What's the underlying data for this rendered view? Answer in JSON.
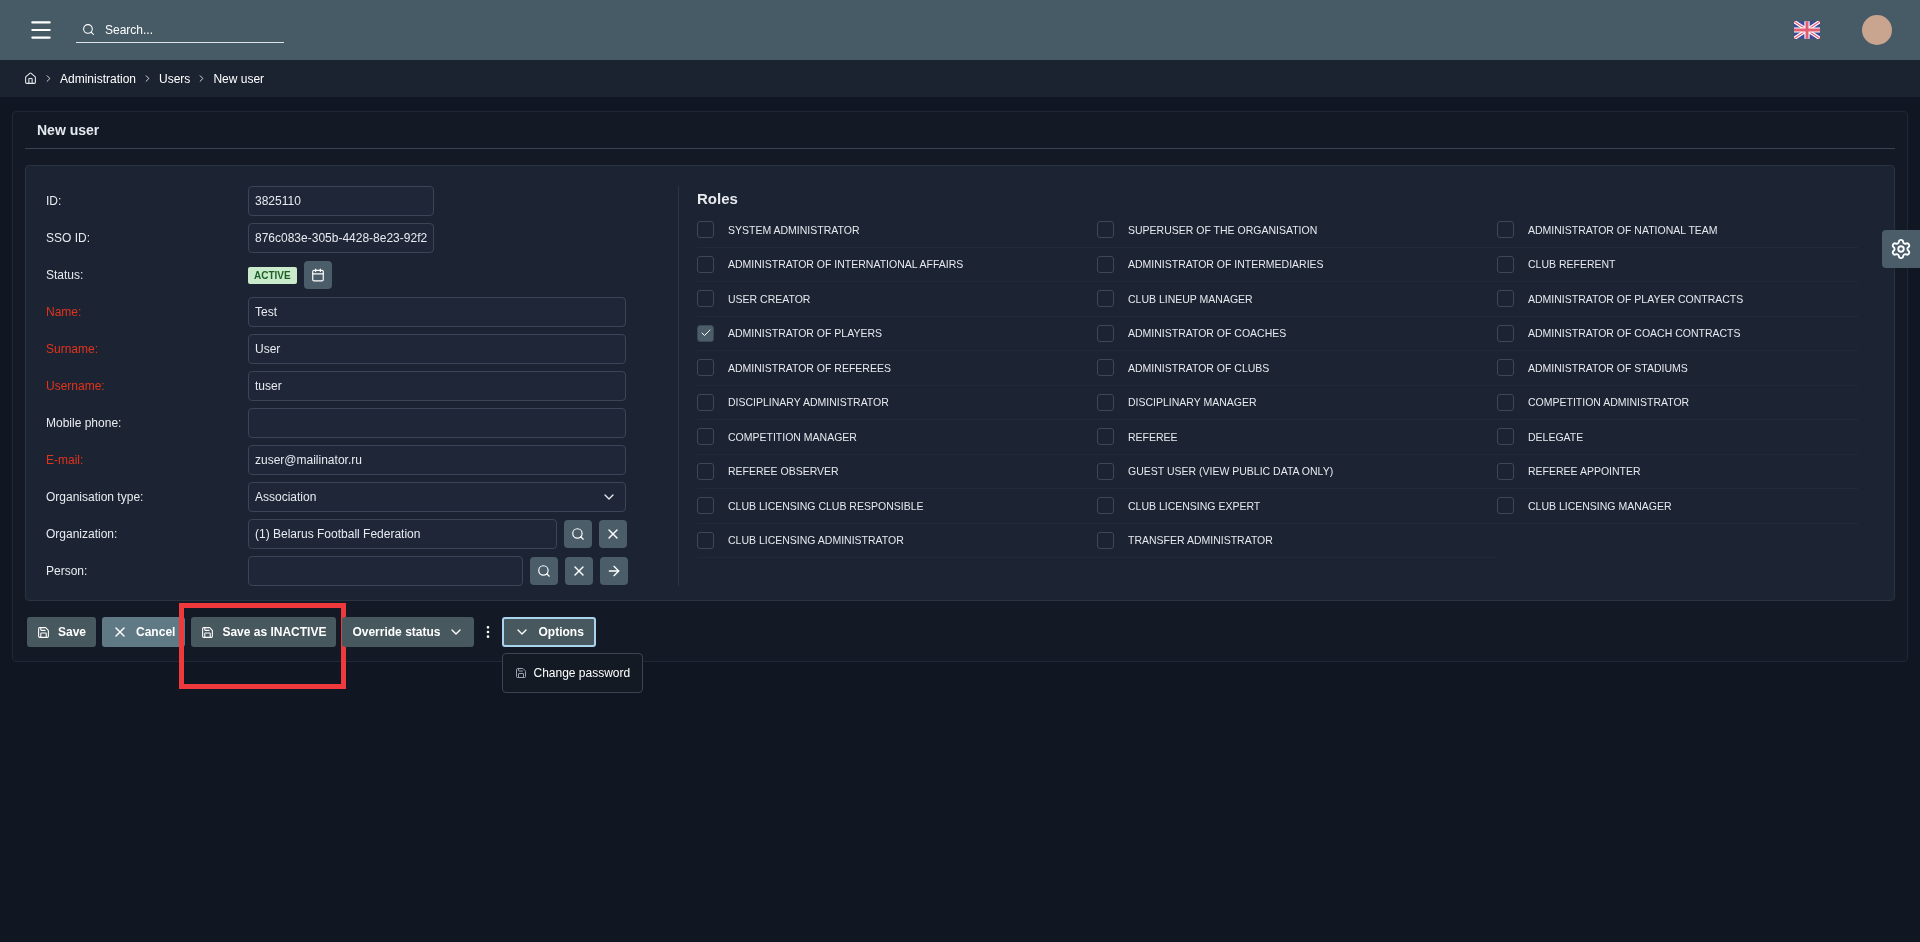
{
  "topbar": {
    "search": {
      "placeholder": "Search..."
    }
  },
  "breadcrumb": [
    "Administration",
    "Users",
    "New user"
  ],
  "page": {
    "title": "New user"
  },
  "fields": [
    {
      "kind": "text",
      "label": "ID:",
      "required": false,
      "value": "3825110",
      "short": true
    },
    {
      "kind": "text",
      "label": "SSO ID:",
      "required": false,
      "value": "876c083e-305b-4428-8e23-92f2",
      "short": true
    },
    {
      "kind": "status",
      "label": "Status:",
      "required": false,
      "value": "ACTIVE"
    },
    {
      "kind": "text",
      "label": "Name:",
      "required": true,
      "value": "Test",
      "short": false
    },
    {
      "kind": "text",
      "label": "Surname:",
      "required": true,
      "value": "User",
      "short": false
    },
    {
      "kind": "text",
      "label": "Username:",
      "required": true,
      "value": "tuser",
      "short": false
    },
    {
      "kind": "text",
      "label": "Mobile phone:",
      "required": false,
      "short": false
    },
    {
      "kind": "text",
      "label": "E-mail:",
      "required": true,
      "value": "zuser@mailinator.ru",
      "short": false
    },
    {
      "kind": "select",
      "label": "Organisation type:",
      "required": false,
      "value": "Association"
    },
    {
      "kind": "lookup",
      "label": "Organization:",
      "required": false,
      "value": "(1) Belarus Football Federation",
      "with_link": false
    },
    {
      "kind": "lookup",
      "label": "Person:",
      "required": false,
      "with_link": true
    }
  ],
  "roles": {
    "title": "Roles",
    "items": [
      {
        "label": "SYSTEM ADMINISTRATOR",
        "checked": false
      },
      {
        "label": "SUPERUSER OF THE ORGANISATION",
        "checked": false
      },
      {
        "label": "ADMINISTRATOR OF NATIONAL TEAM",
        "checked": false
      },
      {
        "label": "ADMINISTRATOR OF INTERNATIONAL AFFAIRS",
        "checked": false
      },
      {
        "label": "ADMINISTRATOR OF INTERMEDIARIES",
        "checked": false
      },
      {
        "label": "CLUB REFERENT",
        "checked": false
      },
      {
        "label": "USER CREATOR",
        "checked": false
      },
      {
        "label": "CLUB LINEUP MANAGER",
        "checked": false
      },
      {
        "label": "ADMINISTRATOR OF PLAYER CONTRACTS",
        "checked": false
      },
      {
        "label": "ADMINISTRATOR OF PLAYERS",
        "checked": true
      },
      {
        "label": "ADMINISTRATOR OF COACHES",
        "checked": false
      },
      {
        "label": "ADMINISTRATOR OF COACH CONTRACTS",
        "checked": false
      },
      {
        "label": "ADMINISTRATOR OF REFEREES",
        "checked": false
      },
      {
        "label": "ADMINISTRATOR OF CLUBS",
        "checked": false
      },
      {
        "label": "ADMINISTRATOR OF STADIUMS",
        "checked": false
      },
      {
        "label": "DISCIPLINARY ADMINISTRATOR",
        "checked": false
      },
      {
        "label": "DISCIPLINARY MANAGER",
        "checked": false
      },
      {
        "label": "COMPETITION ADMINISTRATOR",
        "checked": false
      },
      {
        "label": "COMPETITION MANAGER",
        "checked": false
      },
      {
        "label": "REFEREE",
        "checked": false
      },
      {
        "label": "DELEGATE",
        "checked": false
      },
      {
        "label": "REFEREE OBSERVER",
        "checked": false
      },
      {
        "label": "GUEST USER (VIEW PUBLIC DATA ONLY)",
        "checked": false
      },
      {
        "label": "REFEREE APPOINTER",
        "checked": false
      },
      {
        "label": "CLUB LICENSING CLUB RESPONSIBLE",
        "checked": false
      },
      {
        "label": "CLUB LICENSING EXPERT",
        "checked": false
      },
      {
        "label": "CLUB LICENSING MANAGER",
        "checked": false
      },
      {
        "label": "CLUB LICENSING ADMINISTRATOR",
        "checked": false
      },
      {
        "label": "TRANSFER ADMINISTRATOR",
        "checked": false
      }
    ]
  },
  "actions": [
    {
      "kind": "save",
      "label": "Save"
    },
    {
      "kind": "cancel",
      "label": "Cancel"
    },
    {
      "kind": "save",
      "label": "Save as INACTIVE",
      "highlighted": true
    },
    {
      "kind": "dropdown",
      "label": "Override status"
    }
  ],
  "options": {
    "label": "Options",
    "expanded": true,
    "items": [
      "Change password"
    ]
  }
}
